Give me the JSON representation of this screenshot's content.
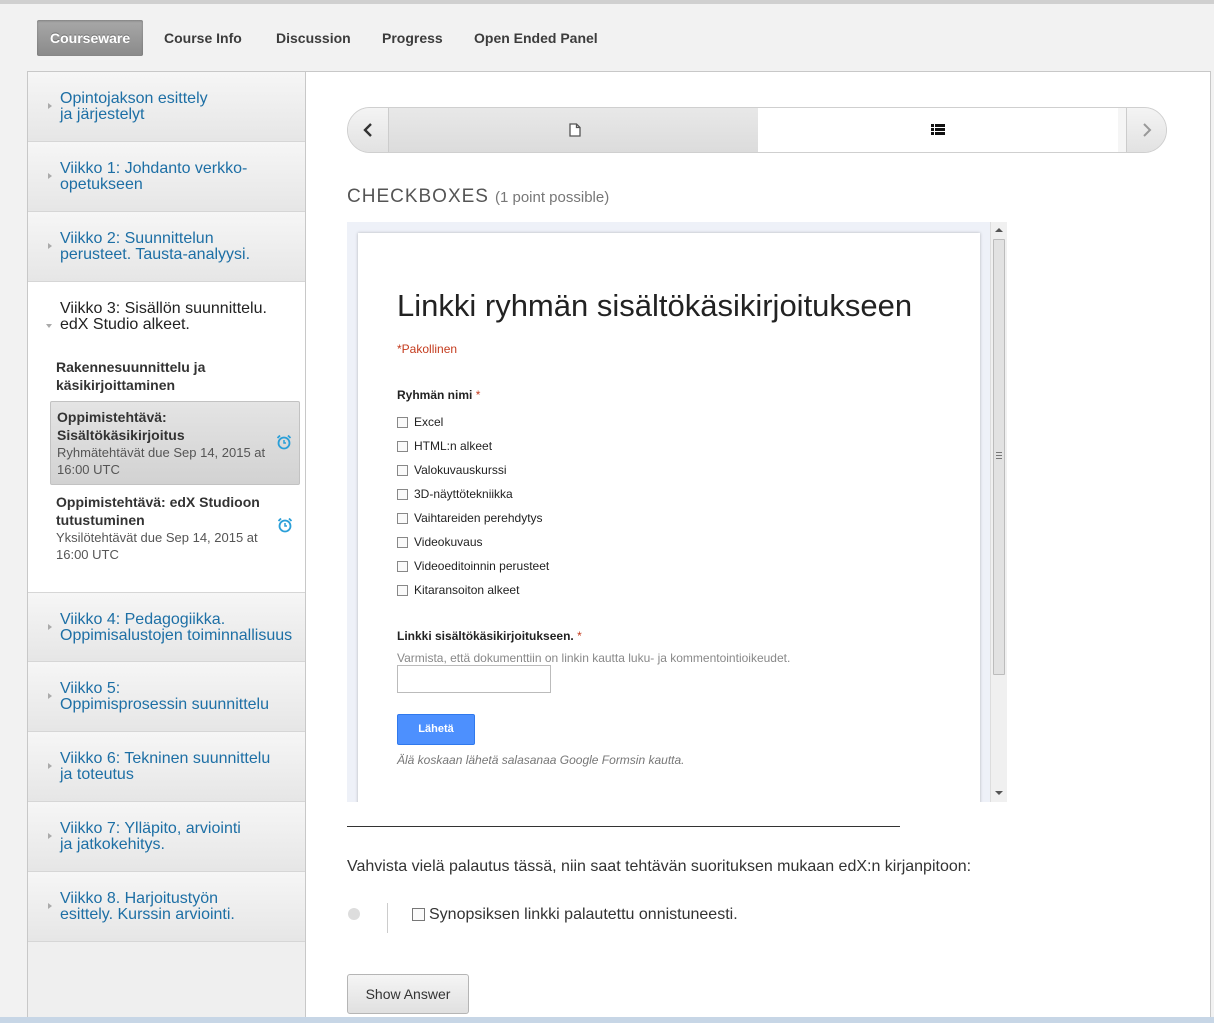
{
  "nav": {
    "tabs": [
      "Courseware",
      "Course Info",
      "Discussion",
      "Progress",
      "Open Ended Panel"
    ],
    "active": "Courseware"
  },
  "sidebar": {
    "chapters": [
      {
        "title": "Opintojakson esittely\nja järjestelyt"
      },
      {
        "title": "Viikko 1: Johdanto verkko-\nopetukseen"
      },
      {
        "title": "Viikko 2: Suunnittelun\nperusteet. Tausta-analyysi."
      },
      {
        "title": "Viikko 3: Sisällön suunnittelu.\nedX Studio alkeet."
      },
      {
        "title": "Viikko 4: Pedagogiikka.\nOppimisalustojen toiminnallisuus"
      },
      {
        "title": "Viikko 5:\nOppimisprosessin suunnittelu"
      },
      {
        "title": "Viikko 6: Tekninen suunnittelu\nja toteutus"
      },
      {
        "title": "Viikko 7: Ylläpito, arviointi\nja jatkokehitys."
      },
      {
        "title": "Viikko 8. Harjoitustyön\nesittely. Kurssin arviointi."
      }
    ],
    "sections": [
      {
        "title": "Rakennesuunnittelu ja käsikirjoittaminen"
      },
      {
        "title": "Oppimistehtävä: Sisältökäsikirjoitus",
        "sub": "Ryhmätehtävät due Sep 14, 2015 at 16:00 UTC"
      },
      {
        "title": "Oppimistehtävä: edX Studioon tutustuminen",
        "sub": "Yksilötehtävät due Sep 14, 2015 at 16:00 UTC"
      }
    ]
  },
  "problem": {
    "heading": "CHECKBOXES",
    "points": "(1 point possible)"
  },
  "form": {
    "title": "Linkki ryhmän sisältökäsikirjoitukseen",
    "required_note": "*Pakollinen",
    "q1_label": "Ryhmän nimi",
    "required_star": "*",
    "options": [
      "Excel",
      "HTML:n alkeet",
      "Valokuvauskurssi",
      "3D-näyttötekniikka",
      "Vaihtareiden perehdytys",
      "Videokuvaus",
      "Videoeditoinnin perusteet",
      "Kitaransoiton alkeet"
    ],
    "q2_label": "Linkki sisältökäsikirjoitukseen.",
    "q2_hint": "Varmista, että dokumenttiin on linkin kautta luku- ja kommentointioikeudet.",
    "submit_label": "Lähetä",
    "password_warning": "Älä koskaan lähetä salasanaa Google Formsin kautta."
  },
  "confirm": {
    "text": "Vahvista vielä palautus tässä, niin saat tehtävän suorituksen mukaan edX:n kirjanpitoon:",
    "checkbox_label": "Synopsiksen linkki palautettu onnistuneesti."
  },
  "buttons": {
    "show_answer": "Show Answer"
  },
  "colors": {
    "link_blue": "#1d6fa5",
    "required_red": "#c43b1d",
    "submit_blue": "#4d90fe",
    "alarm_blue": "#2a9fd8"
  }
}
